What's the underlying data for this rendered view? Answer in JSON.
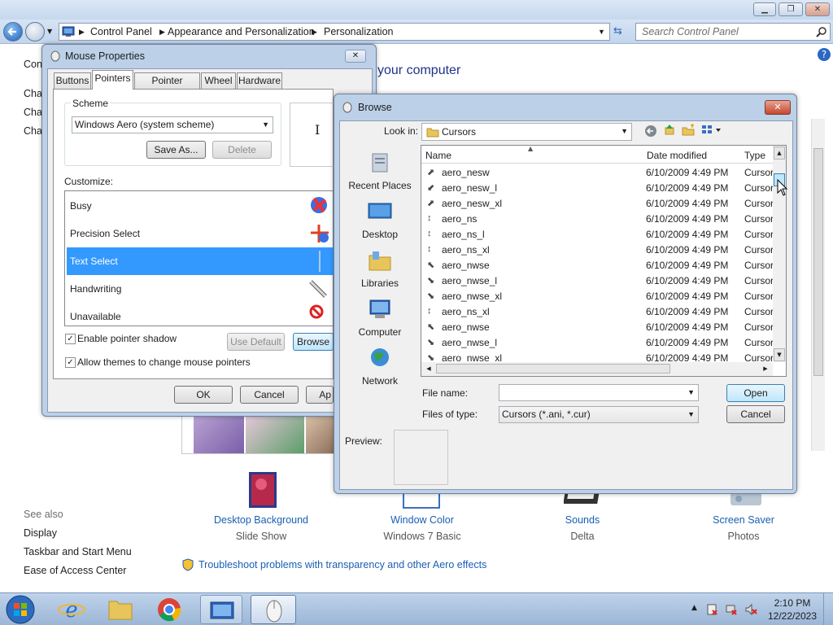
{
  "explorer": {
    "breadcrumb": [
      "Control Panel",
      "Appearance and Personalization",
      "Personalization"
    ],
    "search_placeholder": "Search Control Panel",
    "sidebar": {
      "partial_items": [
        "Con",
        "Cha",
        "Cha",
        "Cha"
      ],
      "see_also_title": "See also",
      "see_also": [
        "Display",
        "Taskbar and Start Menu",
        "Ease of Access Center"
      ]
    },
    "main": {
      "heading_partial": "your computer",
      "themes": [
        {
          "label": "Desktop Background",
          "sub": "Slide Show"
        },
        {
          "label": "Window Color",
          "sub": "Windows 7 Basic"
        },
        {
          "label": "Sounds",
          "sub": "Delta"
        },
        {
          "label": "Screen Saver",
          "sub": "Photos"
        }
      ],
      "troubleshoot_link": "Troubleshoot problems with transparency and other Aero effects"
    }
  },
  "mouse": {
    "title": "Mouse Properties",
    "tabs": [
      "Buttons",
      "Pointers",
      "Pointer Options",
      "Wheel",
      "Hardware"
    ],
    "active_tab": "Pointers",
    "scheme_label": "Scheme",
    "scheme_value": "Windows Aero (system scheme)",
    "save_as": "Save As...",
    "delete": "Delete",
    "customize_label": "Customize:",
    "cursors": [
      "Busy",
      "Precision Select",
      "Text Select",
      "Handwriting",
      "Unavailable"
    ],
    "selected_cursor": "Text Select",
    "shadow_label": "Enable pointer shadow",
    "themes_label": "Allow themes to change mouse pointers",
    "use_default": "Use Default",
    "browse": "Browse",
    "ok": "OK",
    "cancel": "Cancel",
    "apply_partial": "Ap"
  },
  "browse": {
    "title": "Browse",
    "look_in_label": "Look in:",
    "look_in_value": "Cursors",
    "places": [
      "Recent Places",
      "Desktop",
      "Libraries",
      "Computer",
      "Network"
    ],
    "columns": [
      "Name",
      "Date modified",
      "Type"
    ],
    "files": [
      {
        "name": "aero_nesw",
        "date": "6/10/2009 4:49 PM",
        "type": "Cursor"
      },
      {
        "name": "aero_nesw_l",
        "date": "6/10/2009 4:49 PM",
        "type": "Cursor"
      },
      {
        "name": "aero_nesw_xl",
        "date": "6/10/2009 4:49 PM",
        "type": "Cursor"
      },
      {
        "name": "aero_ns",
        "date": "6/10/2009 4:49 PM",
        "type": "Cursor"
      },
      {
        "name": "aero_ns_l",
        "date": "6/10/2009 4:49 PM",
        "type": "Cursor"
      },
      {
        "name": "aero_ns_xl",
        "date": "6/10/2009 4:49 PM",
        "type": "Cursor"
      },
      {
        "name": "aero_nwse",
        "date": "6/10/2009 4:49 PM",
        "type": "Cursor"
      },
      {
        "name": "aero_nwse_l",
        "date": "6/10/2009 4:49 PM",
        "type": "Cursor"
      },
      {
        "name": "aero_nwse_xl",
        "date": "6/10/2009 4:49 PM",
        "type": "Cursor"
      },
      {
        "name": "aero_ns_xl",
        "date": "6/10/2009 4:49 PM",
        "type": "Cursor"
      },
      {
        "name": "aero_nwse",
        "date": "6/10/2009 4:49 PM",
        "type": "Cursor"
      },
      {
        "name": "aero_nwse_l",
        "date": "6/10/2009 4:49 PM",
        "type": "Cursor"
      },
      {
        "name": "aero_nwse_xl",
        "date": "6/10/2009 4:49 PM",
        "type": "Cursor"
      }
    ],
    "file_name_label": "File name:",
    "file_name_value": "",
    "files_of_type_label": "Files of type:",
    "files_of_type_value": "Cursors (*.ani, *.cur)",
    "open": "Open",
    "cancel": "Cancel",
    "preview_label": "Preview:"
  },
  "taskbar": {
    "time": "2:10 PM",
    "date": "12/22/2023"
  },
  "colors": {
    "selection": "#3399ff",
    "link": "#1a5fb4",
    "taskbar": "#9cb6d6"
  }
}
